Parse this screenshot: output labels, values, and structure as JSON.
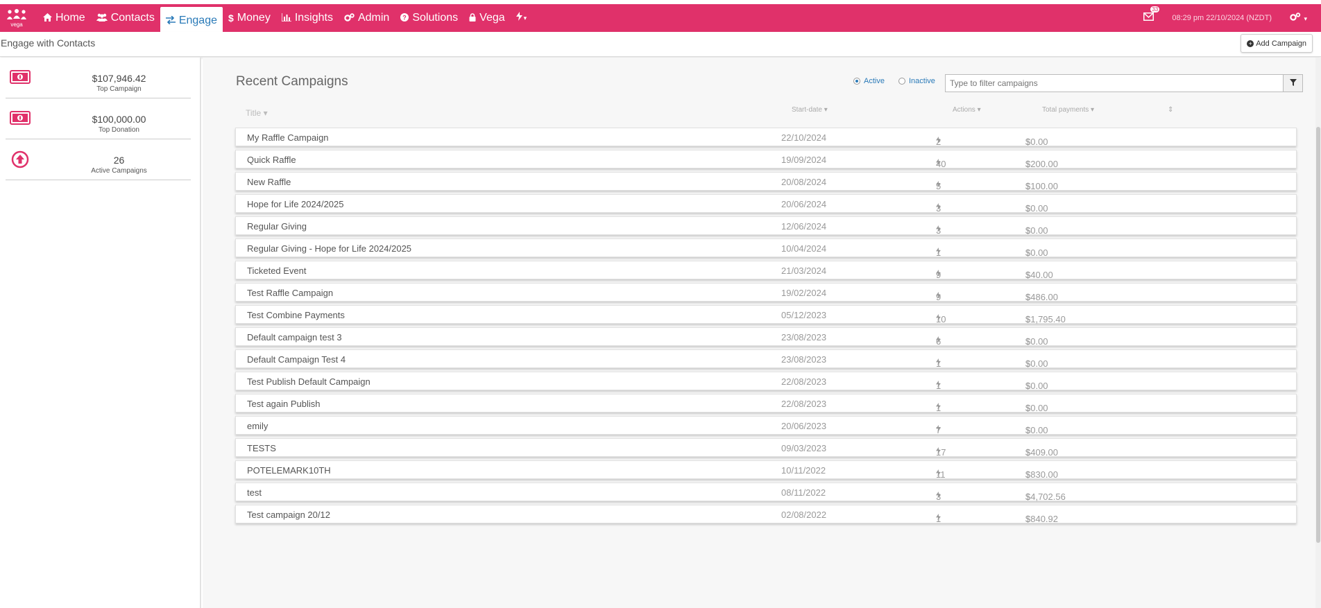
{
  "colors": {
    "brand": "#e0316a",
    "accent": "#2a7ab8"
  },
  "nav": {
    "logo_text": "vega",
    "items": [
      {
        "label": "Home",
        "icon": "home-icon"
      },
      {
        "label": "Contacts",
        "icon": "users-icon"
      },
      {
        "label": "Engage",
        "icon": "exchange-icon"
      },
      {
        "label": "Money",
        "icon": "dollar-icon"
      },
      {
        "label": "Insights",
        "icon": "bar-chart-icon"
      },
      {
        "label": "Admin",
        "icon": "cogs-icon"
      },
      {
        "label": "Solutions",
        "icon": "question-circle-icon"
      },
      {
        "label": "Vega",
        "icon": "lock-icon"
      }
    ],
    "active": "Engage",
    "mail_badge": "33",
    "clock": "08:29 pm 22/10/2024 (NZDT)"
  },
  "subheader": {
    "title": "Engage with Contacts",
    "add_button": "Add Campaign"
  },
  "stats": [
    {
      "value": "$107,946.42",
      "label": "Top Campaign",
      "icon": "money-bill-icon"
    },
    {
      "value": "$100,000.00",
      "label": "Top Donation",
      "icon": "money-bill-icon"
    },
    {
      "value": "26",
      "label": "Active Campaigns",
      "icon": "arrow-circle-up-icon"
    }
  ],
  "main": {
    "title": "Recent Campaigns",
    "radio_active": "Active",
    "radio_inactive": "Inactive",
    "filter_placeholder": "Type to filter campaigns",
    "columns": {
      "title": "Title",
      "start": "Start-date",
      "actions": "Actions",
      "total": "Total payments"
    },
    "rows": [
      {
        "title": "My Raffle Campaign",
        "date": "22/10/2024",
        "actions": "2",
        "total": "$0.00"
      },
      {
        "title": "Quick Raffle",
        "date": "19/09/2024",
        "actions": "40",
        "total": "$200.00"
      },
      {
        "title": "New Raffle",
        "date": "20/08/2024",
        "actions": "5",
        "total": "$100.00"
      },
      {
        "title": "Hope for Life 2024/2025",
        "date": "20/06/2024",
        "actions": "3",
        "total": "$0.00"
      },
      {
        "title": "Regular Giving",
        "date": "12/06/2024",
        "actions": "3",
        "total": "$0.00"
      },
      {
        "title": "Regular Giving - Hope for Life 2024/2025",
        "date": "10/04/2024",
        "actions": "1",
        "total": "$0.00"
      },
      {
        "title": "Ticketed Event",
        "date": "21/03/2024",
        "actions": "9",
        "total": "$40.00"
      },
      {
        "title": "Test Raffle Campaign",
        "date": "19/02/2024",
        "actions": "9",
        "total": "$486.00"
      },
      {
        "title": "Test Combine Payments",
        "date": "05/12/2023",
        "actions": "10",
        "total": "$1,795.40"
      },
      {
        "title": "Default campaign test 3",
        "date": "23/08/2023",
        "actions": "6",
        "total": "$0.00"
      },
      {
        "title": "Default Campaign Test 4",
        "date": "23/08/2023",
        "actions": "1",
        "total": "$0.00"
      },
      {
        "title": "Test Publish Default Campaign",
        "date": "22/08/2023",
        "actions": "1",
        "total": "$0.00"
      },
      {
        "title": "Test again Publish",
        "date": "22/08/2023",
        "actions": "1",
        "total": "$0.00"
      },
      {
        "title": "emily",
        "date": "20/06/2023",
        "actions": "7",
        "total": "$0.00"
      },
      {
        "title": "TESTS",
        "date": "09/03/2023",
        "actions": "17",
        "total": "$409.00"
      },
      {
        "title": "POTELEMARK10TH",
        "date": "10/11/2022",
        "actions": "11",
        "total": "$830.00"
      },
      {
        "title": "test",
        "date": "08/11/2022",
        "actions": "3",
        "total": "$4,702.56"
      },
      {
        "title": "Test campaign 20/12",
        "date": "02/08/2022",
        "actions": "1",
        "total": "$840.92"
      }
    ]
  }
}
